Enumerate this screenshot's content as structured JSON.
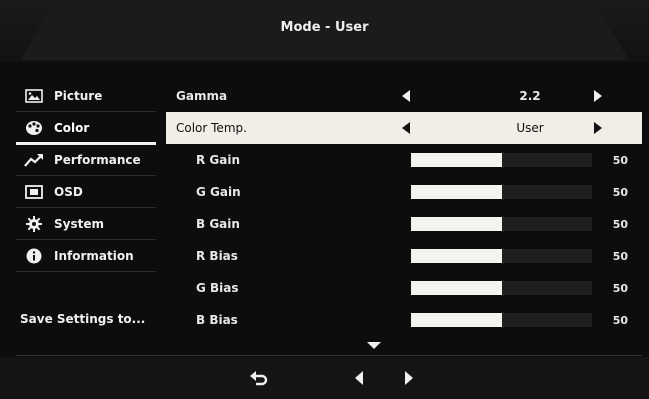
{
  "header": {
    "title": "Mode - User"
  },
  "sidebar": {
    "items": [
      {
        "label": "Picture",
        "icon": "picture-icon"
      },
      {
        "label": "Color",
        "icon": "palette-icon"
      },
      {
        "label": "Performance",
        "icon": "performance-icon"
      },
      {
        "label": "OSD",
        "icon": "osd-icon"
      },
      {
        "label": "System",
        "icon": "gear-icon"
      },
      {
        "label": "Information",
        "icon": "info-icon"
      }
    ],
    "active": "Color",
    "save_label": "Save Settings to..."
  },
  "settings": {
    "gamma": {
      "label": "Gamma",
      "value": "2.2"
    },
    "color_temp": {
      "label": "Color Temp.",
      "value": "User"
    },
    "sliders": [
      {
        "label": "R Gain",
        "value": "50",
        "fraction": 0.5
      },
      {
        "label": "G Gain",
        "value": "50",
        "fraction": 0.5
      },
      {
        "label": "B Gain",
        "value": "50",
        "fraction": 0.5
      },
      {
        "label": "R Bias",
        "value": "50",
        "fraction": 0.5
      },
      {
        "label": "G Bias",
        "value": "50",
        "fraction": 0.5
      },
      {
        "label": "B Bias",
        "value": "50",
        "fraction": 0.5
      }
    ]
  },
  "footer": {
    "icons": [
      "back-icon",
      "left-arrow-icon",
      "right-arrow-icon"
    ]
  },
  "colors": {
    "highlight": "#f1ede7",
    "background": "#0d0d0d",
    "bar_fill": "#f5f3ef"
  }
}
